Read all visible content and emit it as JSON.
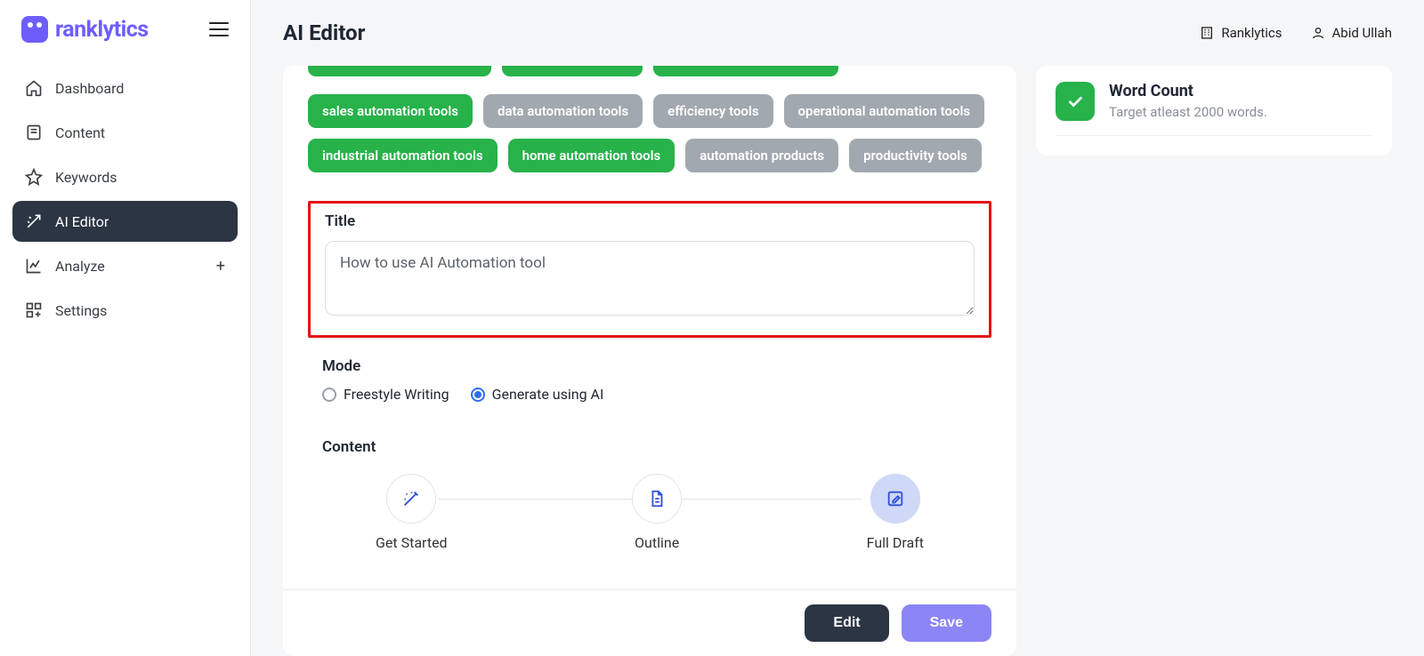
{
  "brand": {
    "name": "ranklytics"
  },
  "header": {
    "page_title": "AI Editor",
    "org_name": "Ranklytics",
    "user_name": "Abid Ullah"
  },
  "sidebar": {
    "items": [
      {
        "label": "Dashboard"
      },
      {
        "label": "Content"
      },
      {
        "label": "Keywords"
      },
      {
        "label": "AI Editor"
      },
      {
        "label": "Analyze"
      },
      {
        "label": "Settings"
      }
    ]
  },
  "tags": [
    {
      "label": "sales automation tools",
      "variant": "green"
    },
    {
      "label": "data automation tools",
      "variant": "grey"
    },
    {
      "label": "efficiency tools",
      "variant": "grey"
    },
    {
      "label": "operational automation tools",
      "variant": "grey"
    },
    {
      "label": "industrial automation tools",
      "variant": "green"
    },
    {
      "label": "home automation tools",
      "variant": "green"
    },
    {
      "label": "automation products",
      "variant": "grey"
    },
    {
      "label": "productivity tools",
      "variant": "grey"
    }
  ],
  "title_section": {
    "label": "Title",
    "value": "How to use AI Automation tool"
  },
  "mode_section": {
    "label": "Mode",
    "options": [
      {
        "label": "Freestyle Writing",
        "selected": false
      },
      {
        "label": "Generate using AI",
        "selected": true
      }
    ]
  },
  "content_section": {
    "label": "Content",
    "steps": [
      {
        "label": "Get Started"
      },
      {
        "label": "Outline"
      },
      {
        "label": "Full Draft"
      }
    ]
  },
  "footer": {
    "edit": "Edit",
    "save": "Save"
  },
  "side": {
    "word_count_title": "Word Count",
    "word_count_sub": "Target atleast 2000 words."
  }
}
